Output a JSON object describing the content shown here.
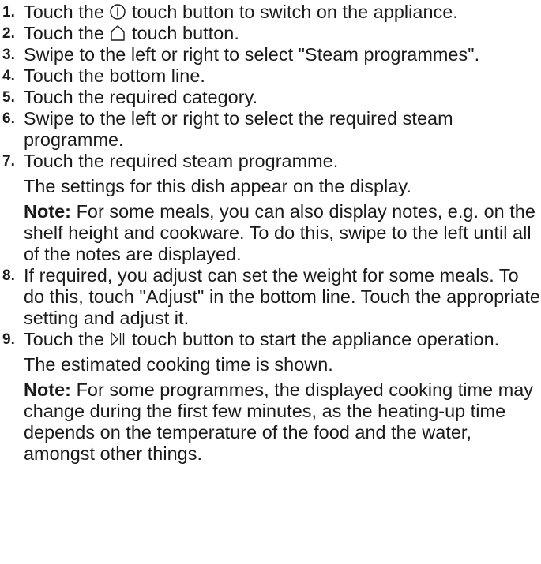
{
  "steps": [
    {
      "num": "1.",
      "before": "Touch the ",
      "icon": "power-icon",
      "after": " touch button to switch on the appliance."
    },
    {
      "num": "2.",
      "before": "Touch the ",
      "icon": "home-icon",
      "after": " touch button."
    },
    {
      "num": "3.",
      "text": "Swipe to the left or right to select \"Steam programmes\"."
    },
    {
      "num": "4.",
      "text": "Touch the bottom line."
    },
    {
      "num": "5.",
      "text": "Touch the required category."
    },
    {
      "num": "6.",
      "text": "Swipe to the left or right to select the required steam programme."
    },
    {
      "num": "7.",
      "text": "Touch the required steam programme.",
      "result": "The settings for this dish appear on the display.",
      "note_label": "Note:",
      "note": " For some meals, you can also display notes, e.g. on the shelf height and cookware. To do this, swipe to the left until all of the notes are displayed."
    },
    {
      "num": "8.",
      "text": "If required, you adjust can set the weight for some meals. To do this, touch \"Adjust\" in the bottom line. Touch the appropriate setting and adjust it."
    },
    {
      "num": "9.",
      "before": "Touch the ",
      "icon": "start-pause-icon",
      "after": " touch button to start the appliance operation.",
      "result": "The estimated cooking time is shown.",
      "note_label": "Note:",
      "note": " For some programmes, the displayed cooking time may change during the first few minutes, as the heating-up time depends on the temperature of the food and the water, amongst other things."
    }
  ]
}
